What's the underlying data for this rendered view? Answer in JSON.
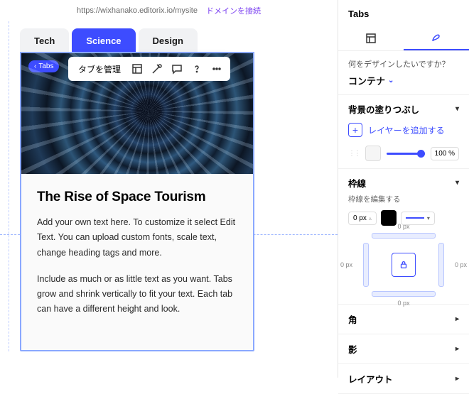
{
  "urlbar": {
    "url": "https://wixhanako.editorix.io/mysite",
    "domain_link": "ドメインを接続"
  },
  "tabs": {
    "items": [
      "Tech",
      "Science",
      "Design"
    ],
    "active_index": 1
  },
  "toolbar": {
    "manage_label": "タブを管理"
  },
  "hero_badge": {
    "arrow": "‹",
    "text": "Tabs"
  },
  "article": {
    "title": "The Rise of Space Tourism",
    "p1": "Add your own text here. To customize it select Edit Text. You can upload custom fonts, scale text, change heading tags and more.",
    "p2": "Include as much or as little text as you want. Tabs grow and shrink vertically to fit your text. Each tab can have a different height and look."
  },
  "panel": {
    "title": "Tabs",
    "design_q": "何をデザインしたいですか？",
    "design_target": "コンテナ",
    "fill": {
      "title": "背景の塗りつぶし",
      "add_layer": "レイヤーを追加する",
      "opacity": "100 %"
    },
    "border": {
      "title": "枠線",
      "edit_label": "枠線を編集する",
      "width": "0 px",
      "top": "0 px",
      "bottom": "0 px",
      "left": "0 px",
      "right": "0 px"
    },
    "sections": {
      "corner": "角",
      "shadow": "影",
      "layout": "レイアウト"
    }
  }
}
